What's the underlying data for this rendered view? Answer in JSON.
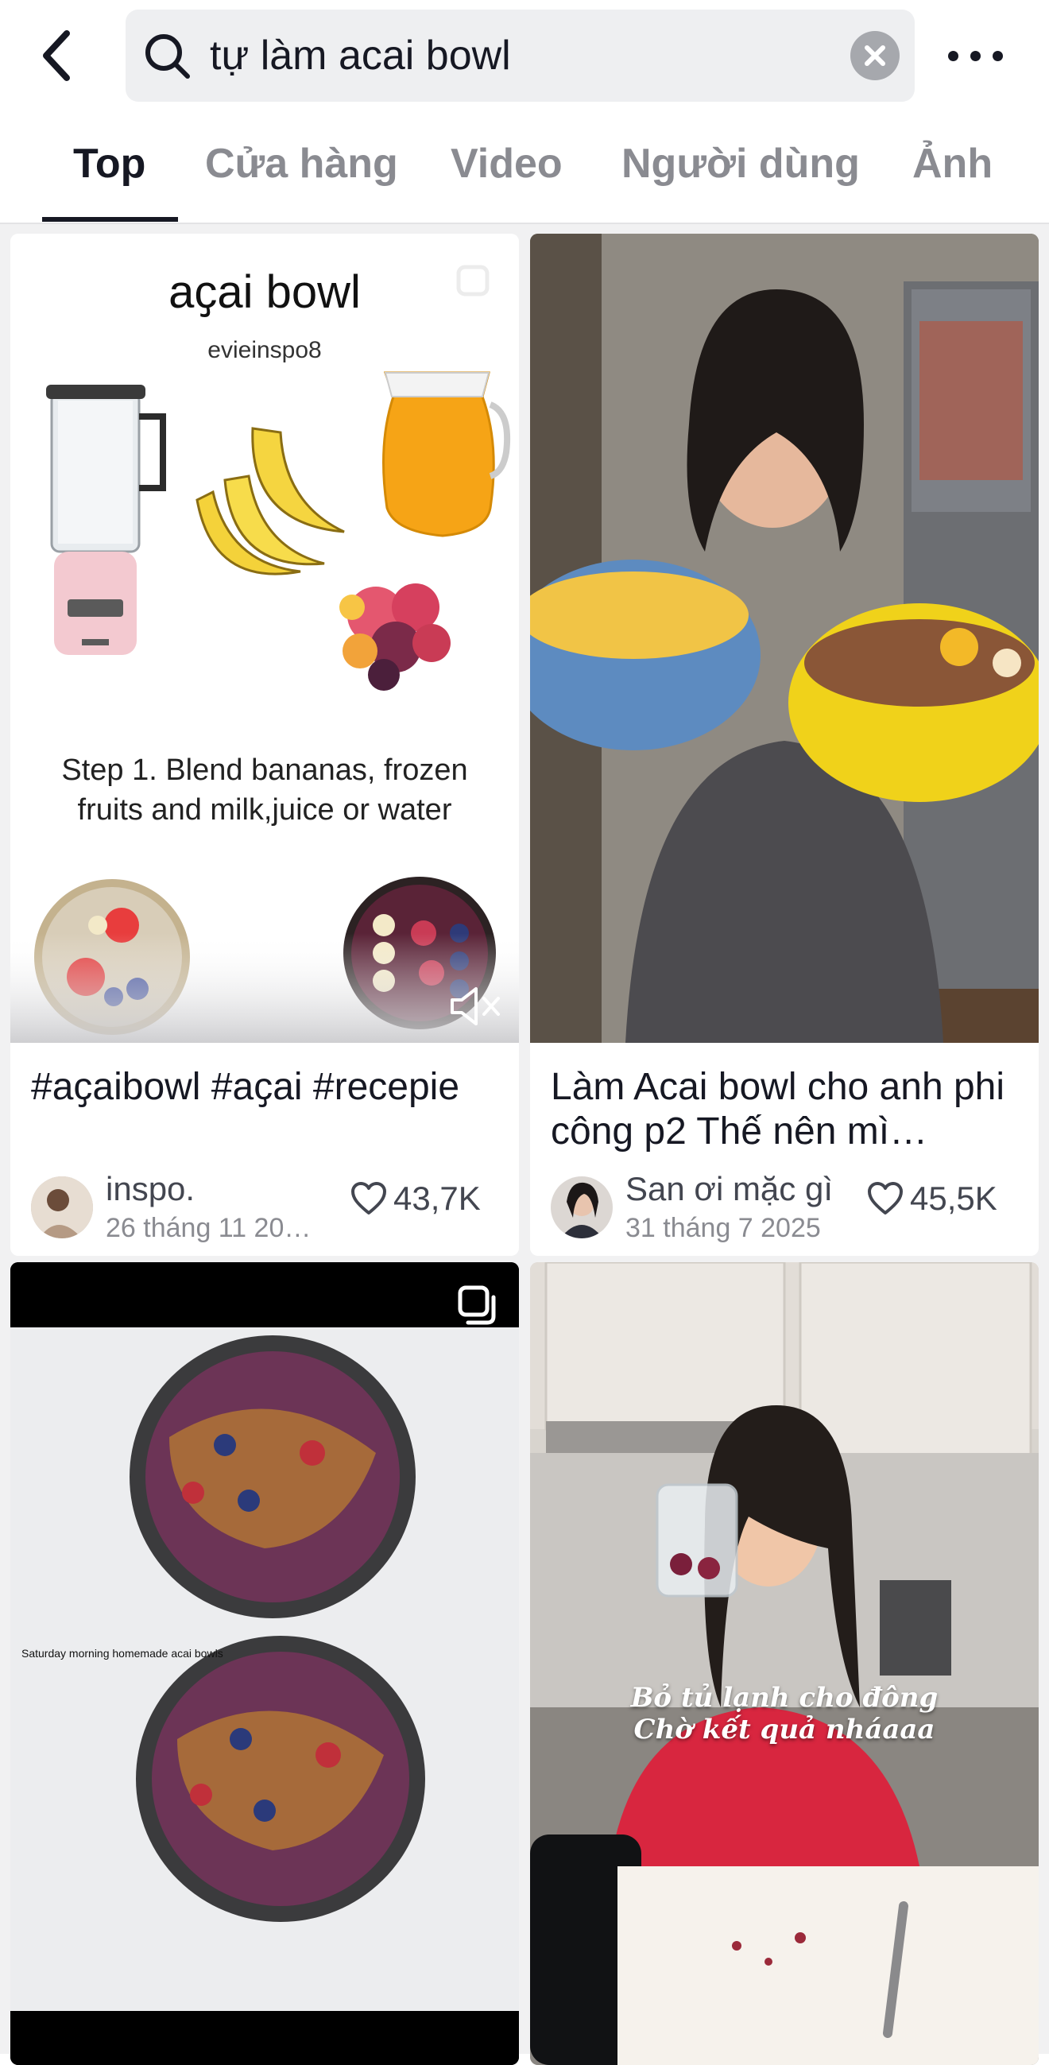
{
  "search": {
    "query": "tự làm acai bowl"
  },
  "tabs": [
    {
      "label": "Top",
      "active": true
    },
    {
      "label": "Cửa hàng",
      "active": false
    },
    {
      "label": "Video",
      "active": false
    },
    {
      "label": "Người dùng",
      "active": false
    },
    {
      "label": "Ảnh",
      "active": false
    }
  ],
  "cards": [
    {
      "thumb_title": "aҫai bowl",
      "thumb_author": "evieinspo8",
      "thumb_step": "Step 1. Blend bananas, frozen fruits and milk,juice or water",
      "caption": "#aҫaibowl #aҫai #recepie",
      "author": "inspo.",
      "date": "26 tháng 11 20…",
      "likes": "43,7K",
      "muted_icon": "volume-mute-icon"
    },
    {
      "caption": "Làm Acai bowl cho anh phi công p2 Thế nên mì…",
      "author": "San ơi mặc gì",
      "date": "31 tháng 7 2025",
      "likes": "45,5K"
    },
    {
      "thumb_label": "Saturday morning homemade acai bowls",
      "badge_icon": "photo-carousel-icon"
    },
    {
      "overlay_line1": "Bỏ tủ lạnh cho đông",
      "overlay_line2": "Chờ kết quả nháaaa"
    }
  ],
  "colors": {
    "text": "#161823",
    "muted": "#8a8b91",
    "search_bg": "#eeeff1",
    "feed_bg": "#f1f1f2"
  }
}
